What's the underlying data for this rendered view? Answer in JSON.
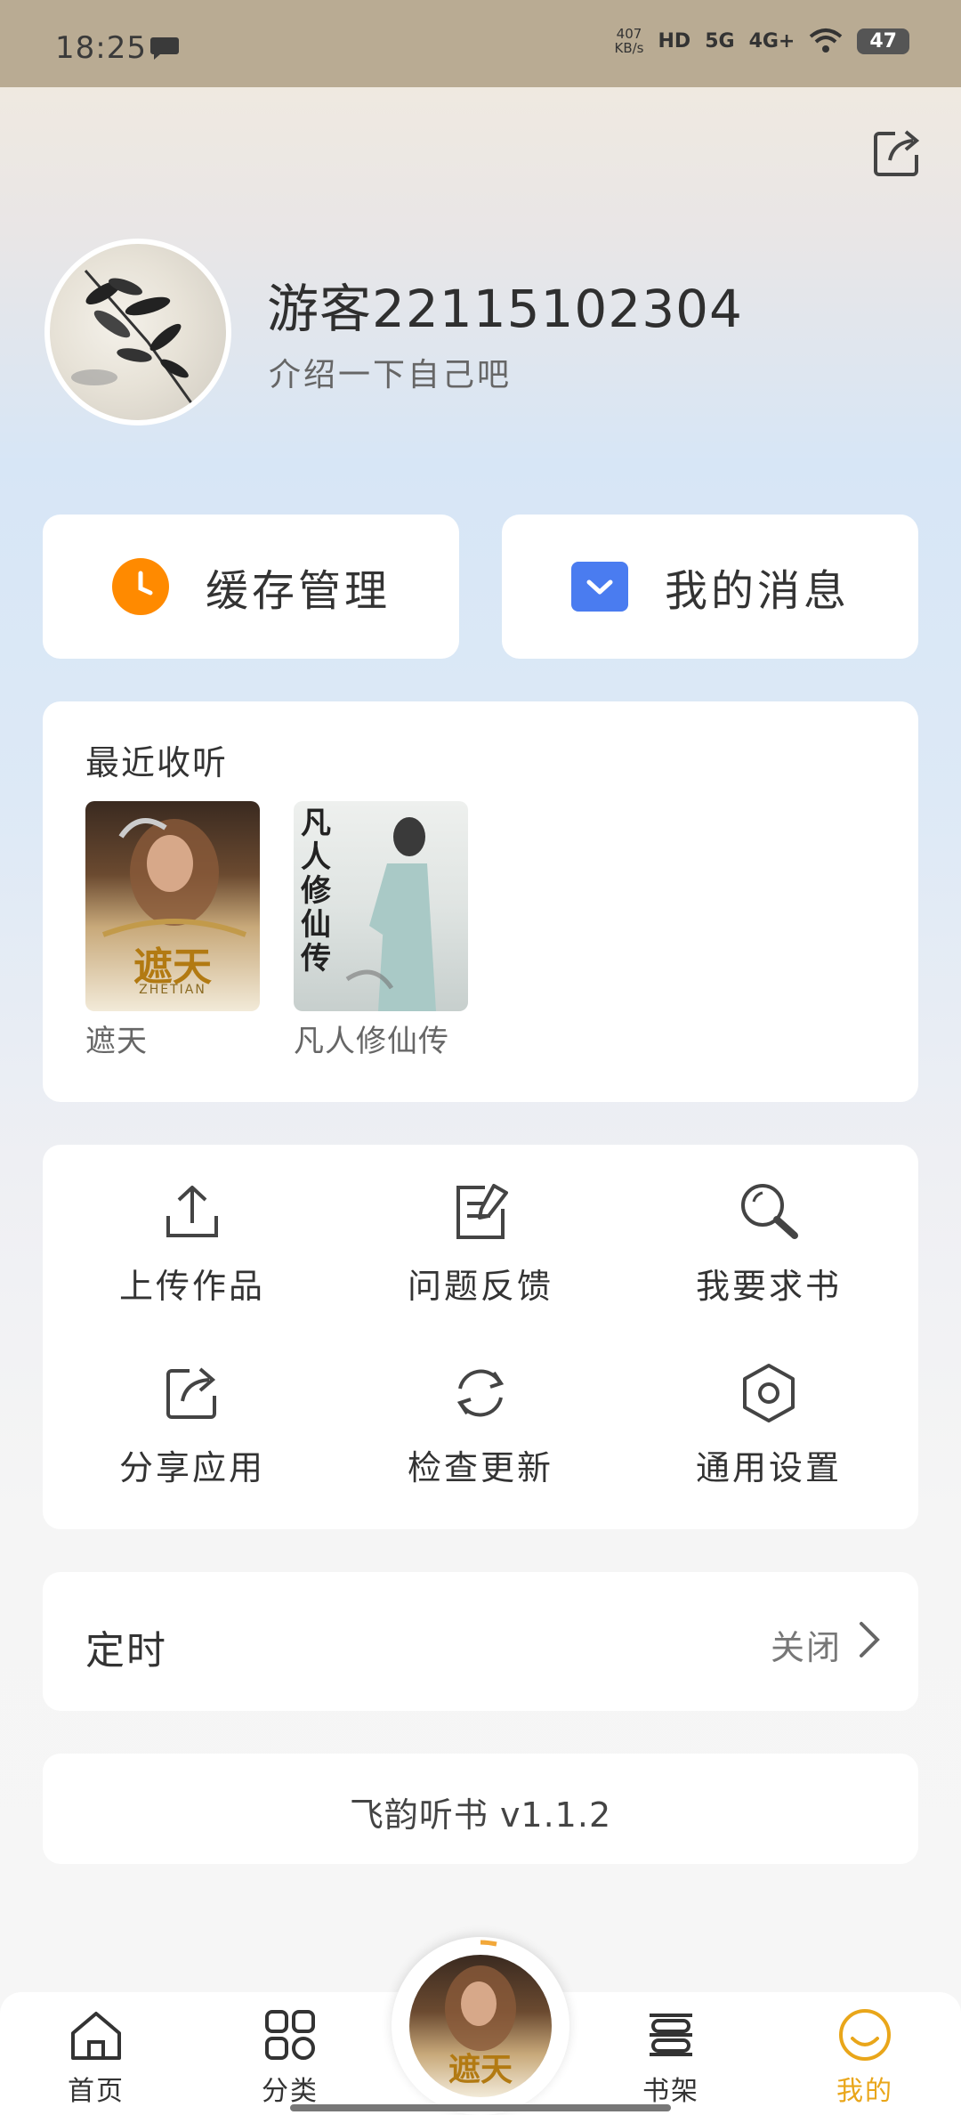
{
  "status_bar": {
    "time": "18:25",
    "speed_value": "407",
    "speed_unit": "KB/s",
    "hd": "HD",
    "net1": "5G",
    "net2": "4G+",
    "battery": "47"
  },
  "profile": {
    "username": "游客22115102304",
    "bio": "介绍一下自己吧"
  },
  "quick_actions": [
    {
      "label": "缓存管理",
      "icon": "clock-icon",
      "color": "#ff8a00"
    },
    {
      "label": "我的消息",
      "icon": "message-icon",
      "color": "#4a7cf0"
    }
  ],
  "recent": {
    "title": "最近收听",
    "books": [
      {
        "title": "遮天",
        "cover_text": "遮天",
        "cover_sub": "ZHETIAN"
      },
      {
        "title": "凡人修仙传",
        "cover_text": "凡人修仙传"
      }
    ]
  },
  "tools": [
    {
      "label": "上传作品",
      "icon": "upload-icon"
    },
    {
      "label": "问题反馈",
      "icon": "edit-icon"
    },
    {
      "label": "我要求书",
      "icon": "search-icon"
    },
    {
      "label": "分享应用",
      "icon": "share-icon"
    },
    {
      "label": "检查更新",
      "icon": "refresh-icon"
    },
    {
      "label": "通用设置",
      "icon": "settings-icon"
    }
  ],
  "timer": {
    "label": "定时",
    "value": "关闭"
  },
  "version": "飞韵听书 v1.1.2",
  "bottom_nav": [
    {
      "label": "首页",
      "icon": "home-icon"
    },
    {
      "label": "分类",
      "icon": "category-icon"
    },
    {
      "label": "书架",
      "icon": "bookshelf-icon"
    },
    {
      "label": "我的",
      "icon": "profile-icon",
      "active": true
    }
  ],
  "colors": {
    "accent": "#e9a61a",
    "orange": "#ff8a00",
    "blue": "#4a7cf0"
  }
}
